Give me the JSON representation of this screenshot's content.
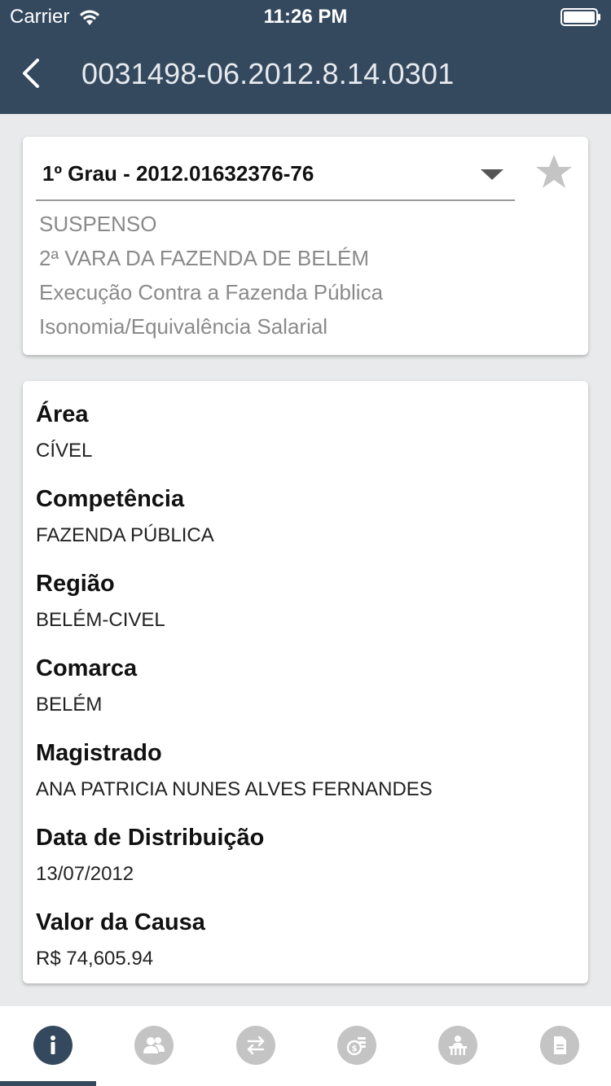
{
  "status_bar": {
    "carrier": "Carrier",
    "time": "11:26 PM"
  },
  "nav": {
    "title": "0031498-06.2012.8.14.0301"
  },
  "process_card": {
    "grau_selected": "1º Grau - 2012.01632376-76",
    "status_lines": [
      "SUSPENSO",
      "2ª VARA DA FAZENDA DE BELÉM",
      "Execução Contra a Fazenda Pública",
      "Isonomia/Equivalência Salarial"
    ]
  },
  "details": [
    {
      "label": "Área",
      "value": "CÍVEL"
    },
    {
      "label": "Competência",
      "value": "FAZENDA PÚBLICA"
    },
    {
      "label": "Região",
      "value": "BELÉM-CIVEL"
    },
    {
      "label": "Comarca",
      "value": "BELÉM"
    },
    {
      "label": "Magistrado",
      "value": "ANA PATRICIA NUNES ALVES FERNANDES"
    },
    {
      "label": "Data de Distribuição",
      "value": "13/07/2012"
    },
    {
      "label": "Valor da Causa",
      "value": "R$ 74,605.94"
    }
  ],
  "tabs": [
    {
      "icon": "info-icon",
      "active": true
    },
    {
      "icon": "people-icon",
      "active": false
    },
    {
      "icon": "transfer-arrows-icon",
      "active": false
    },
    {
      "icon": "coins-icon",
      "active": false
    },
    {
      "icon": "judge-icon",
      "active": false
    },
    {
      "icon": "document-icon",
      "active": false
    }
  ],
  "colors": {
    "header_bg": "#34495e",
    "active_tab": "#34495e",
    "inactive_tab": "#c4c4c4",
    "page_bg": "#e8eaeb"
  }
}
